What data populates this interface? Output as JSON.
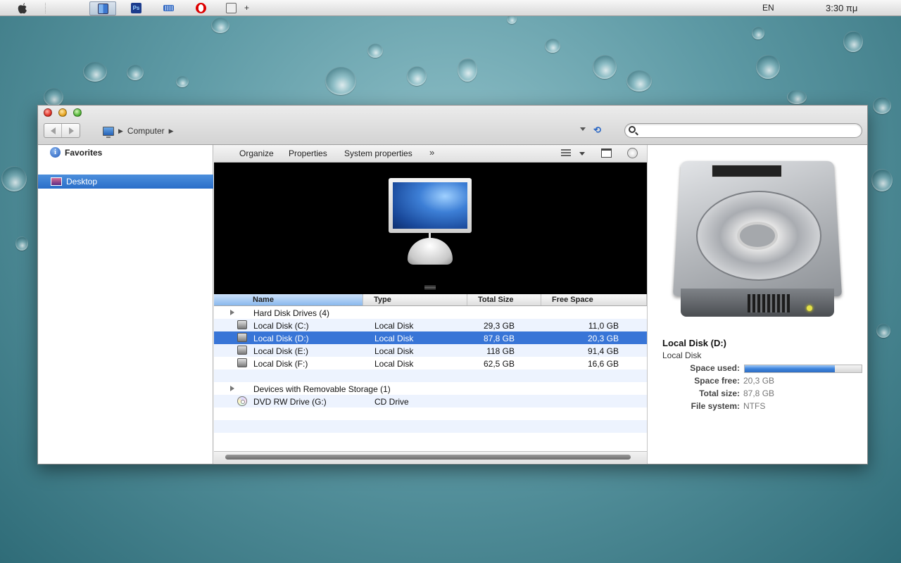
{
  "menubar": {
    "language": "EN",
    "clock": "3:30 πμ",
    "taskbar_icons": [
      "finder-icon",
      "photoshop-icon",
      "keyboard-icon",
      "opera-icon",
      "screenshot-icon"
    ],
    "add_label": "+"
  },
  "window": {
    "breadcrumb": "Computer",
    "search_placeholder": ""
  },
  "sidebar": {
    "favorites_label": "Favorites",
    "desktop_label": "Desktop"
  },
  "toolbar": {
    "organize": "Organize",
    "properties": "Properties",
    "system_properties": "System properties",
    "more": "»"
  },
  "list": {
    "columns": [
      "Name",
      "Type",
      "Total Size",
      "Free Space"
    ],
    "groups": [
      {
        "label": "Hard Disk Drives (4)",
        "items": [
          {
            "name": "Local Disk (C:)",
            "type": "Local Disk",
            "total": "29,3 GB",
            "free": "11,0 GB"
          },
          {
            "name": "Local Disk (D:)",
            "type": "Local Disk",
            "total": "87,8 GB",
            "free": "20,3 GB",
            "selected": true
          },
          {
            "name": "Local Disk (E:)",
            "type": "Local Disk",
            "total": "118 GB",
            "free": "91,4 GB"
          },
          {
            "name": "Local Disk (F:)",
            "type": "Local Disk",
            "total": "62,5 GB",
            "free": "16,6 GB"
          }
        ]
      },
      {
        "label": "Devices with Removable Storage (1)",
        "items": [
          {
            "name": "DVD RW Drive (G:)",
            "type": "CD Drive",
            "total": "",
            "free": ""
          }
        ]
      }
    ]
  },
  "details": {
    "title": "Local Disk (D:)",
    "type": "Local Disk",
    "space_used_label": "Space used:",
    "space_used_fraction": 0.77,
    "space_free_label": "Space free:",
    "space_free": "20,3 GB",
    "total_size_label": "Total size:",
    "total_size": "87,8 GB",
    "file_system_label": "File system:",
    "file_system": "NTFS"
  },
  "colors": {
    "selection": "#3875d7",
    "accent": "#2a6ec9"
  }
}
